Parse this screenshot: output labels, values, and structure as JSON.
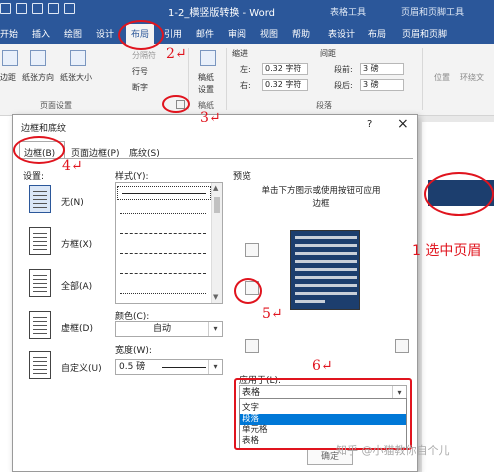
{
  "window": {
    "title": "1-2_横竖版转换 - Word",
    "context_tab_1": "表格工具",
    "context_tab_2": "页眉和页脚工具"
  },
  "ribbon_tabs": [
    {
      "label": "开始"
    },
    {
      "label": "插入"
    },
    {
      "label": "绘图"
    },
    {
      "label": "设计"
    },
    {
      "label": "布局"
    },
    {
      "label": "引用"
    },
    {
      "label": "邮件"
    },
    {
      "label": "审阅"
    },
    {
      "label": "视图"
    },
    {
      "label": "帮助"
    },
    {
      "label": "表设计"
    },
    {
      "label": "布局"
    },
    {
      "label": "页眉和页脚"
    }
  ],
  "ribbon": {
    "margins": "边距",
    "orientation": "纸张方向",
    "size": "纸张大小",
    "breaks": "分隔符",
    "line_numbers": "行号",
    "hyphenation": "断字",
    "page_setup_group": "页面设置",
    "manuscript_1": "稿纸",
    "manuscript_2": "设置",
    "manuscript_group": "稿纸",
    "indent": "缩进",
    "indent_left_label": "左:",
    "indent_left": "0.32 字符",
    "indent_right_label": "右:",
    "indent_right": "0.32 字符",
    "spacing": "间距",
    "before_label": "段前:",
    "before": "3 磅",
    "after_label": "段后:",
    "after": "3 磅",
    "paragraph_group": "段落",
    "position": "位置",
    "wrap": "环绕文"
  },
  "dialog": {
    "title": "边框和底纹",
    "help": "?",
    "tabs": [
      {
        "label": "边框(B)"
      },
      {
        "label": "页面边框(P)"
      },
      {
        "label": "底纹(S)"
      }
    ],
    "setting_label": "设置:",
    "presets": [
      {
        "label": "无(N)"
      },
      {
        "label": "方框(X)"
      },
      {
        "label": "全部(A)"
      },
      {
        "label": "虚框(D)"
      },
      {
        "label": "自定义(U)"
      }
    ],
    "style_label": "样式(Y):",
    "color_label": "颜色(C):",
    "color_value": "自动",
    "width_label": "宽度(W):",
    "width_value": "0.5 磅",
    "preview_label": "预览",
    "preview_hint": "单击下方图示或使用按钮可应用边框",
    "apply_label": "应用于(L):",
    "apply_value": "表格",
    "apply_options": [
      {
        "label": "文字"
      },
      {
        "label": "段落",
        "selected": true
      },
      {
        "label": "单元格"
      },
      {
        "label": "表格"
      }
    ],
    "ok": "确定"
  },
  "annotations": {
    "n1": "1",
    "n1_text": "选中页眉",
    "n2": "2",
    "n3": "3",
    "n4": "4",
    "n5": "5",
    "n6": "6",
    "cursor_mark": "↵"
  },
  "watermark": "知乎 @小猫教你自个儿"
}
